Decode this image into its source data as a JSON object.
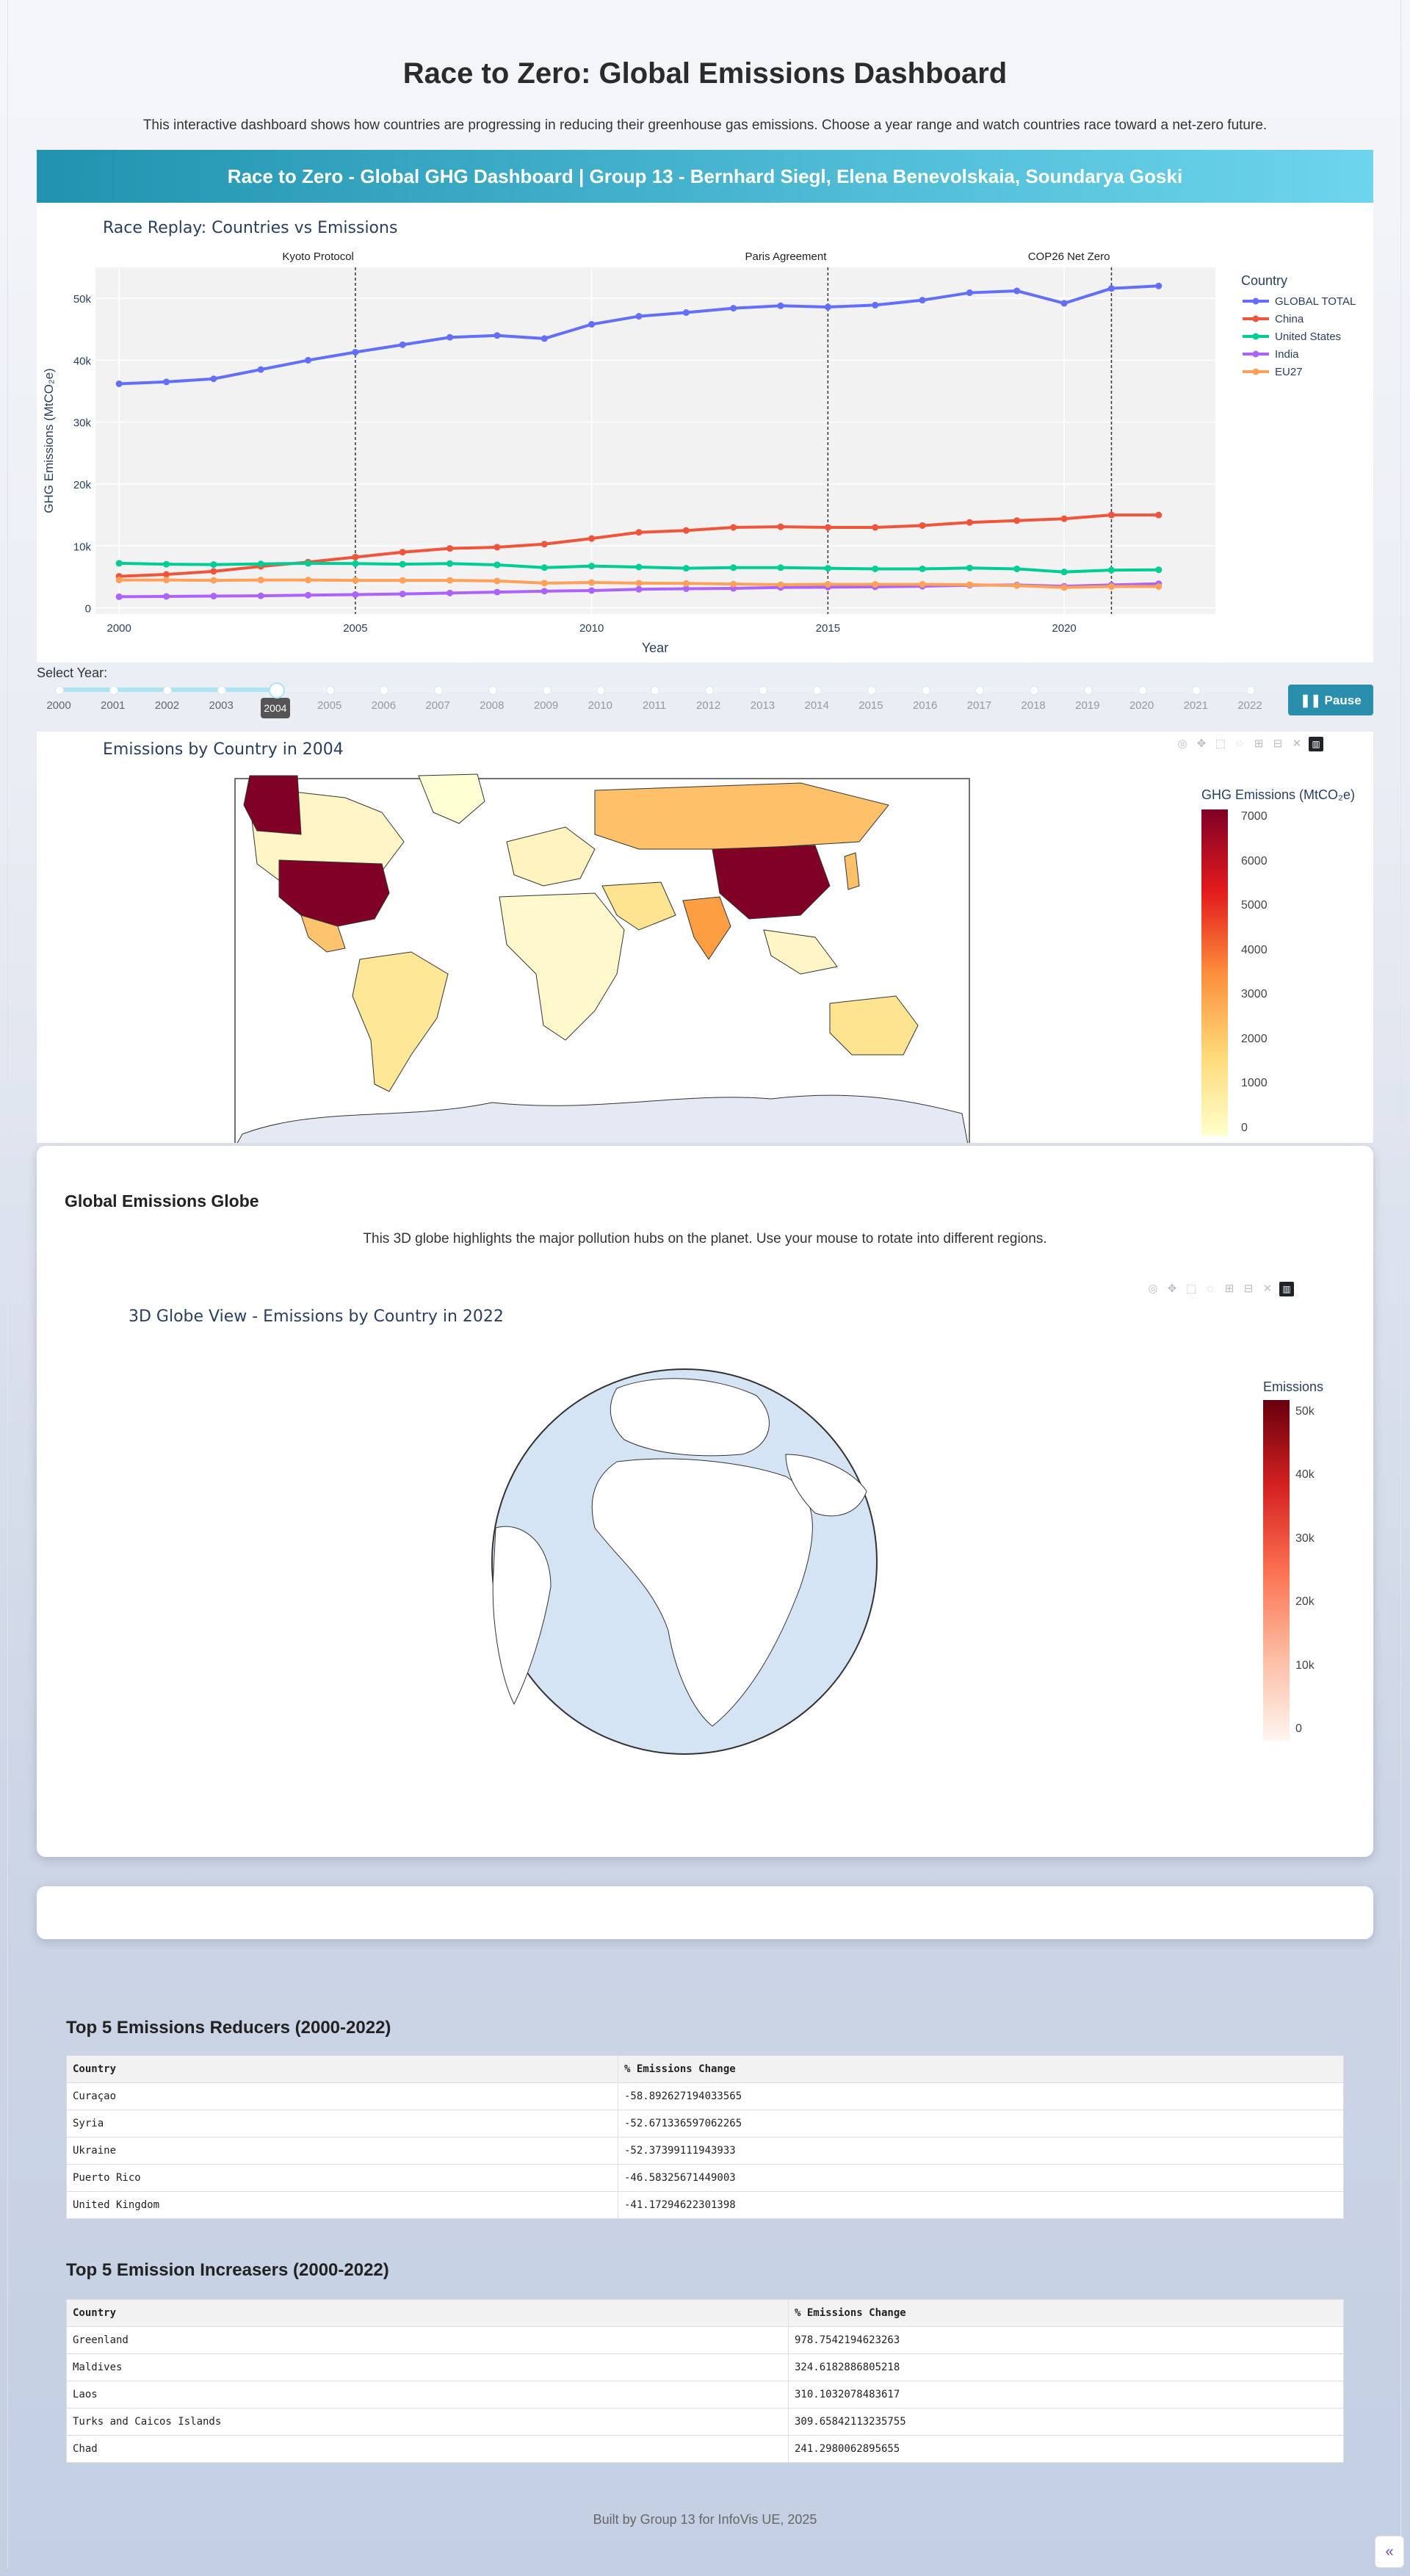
{
  "page": {
    "title": "Race to Zero: Global Emissions Dashboard",
    "intro": "This interactive dashboard shows how countries are progressing in reducing their greenhouse gas emissions. Choose a year range and watch countries race toward a net-zero future.",
    "banner": "Race to Zero - Global GHG Dashboard | Group 13 - Bernhard Siegl, Elena Benevolskaia, Soundarya Goski",
    "footer": "Built by Group 13 for InfoVis UE, 2025",
    "collapse_icon": "«"
  },
  "race_chart": {
    "title": "Race Replay: Countries vs Emissions",
    "legend_title": "Country",
    "annotations": [
      "Kyoto Protocol",
      "Paris Agreement",
      "COP26 Net Zero"
    ]
  },
  "slider": {
    "label": "Select Year:",
    "years": [
      "2000",
      "2001",
      "2002",
      "2003",
      "2004",
      "2005",
      "2006",
      "2007",
      "2008",
      "2009",
      "2010",
      "2011",
      "2012",
      "2013",
      "2014",
      "2015",
      "2016",
      "2017",
      "2018",
      "2019",
      "2020",
      "2021",
      "2022"
    ],
    "selected": "2004",
    "selected_index": 4,
    "pause_label": "❚❚ Pause"
  },
  "map_chart": {
    "title": "Emissions by Country in 2004",
    "colorbar_title": "GHG Emissions (MtCO₂e)",
    "colorbar_ticks": [
      "7000",
      "6000",
      "5000",
      "4000",
      "3000",
      "2000",
      "1000",
      "0"
    ]
  },
  "globe_card": {
    "title": "Global Emissions Globe",
    "description": "This 3D globe highlights the major pollution hubs on the planet. Use your mouse to rotate into different regions.",
    "chart_title": "3D Globe View - Emissions by Country in 2022",
    "colorbar_title": "Emissions",
    "colorbar_ticks": [
      "50k",
      "40k",
      "30k",
      "20k",
      "10k",
      "0"
    ]
  },
  "reducers": {
    "title": "Top 5 Emissions Reducers (2000-2022)",
    "headers": [
      "Country",
      "% Emissions Change"
    ],
    "rows": [
      [
        "Curaçao",
        "-58.892627194033565"
      ],
      [
        "Syria",
        "-52.671336597062265"
      ],
      [
        "Ukraine",
        "-52.37399111943933"
      ],
      [
        "Puerto Rico",
        "-46.58325671449003"
      ],
      [
        "United Kingdom",
        "-41.17294622301398"
      ]
    ]
  },
  "increasers": {
    "title": "Top 5 Emission Increasers (2000-2022)",
    "headers": [
      "Country",
      "% Emissions Change"
    ],
    "rows": [
      [
        "Greenland",
        "978.7542194623263"
      ],
      [
        "Maldives",
        "324.6182886805218"
      ],
      [
        "Laos",
        "310.1032078483617"
      ],
      [
        "Turks and Caicos Islands",
        "309.65842113235755"
      ],
      [
        "Chad",
        "241.2980062895655"
      ]
    ]
  },
  "chart_data": {
    "type": "line",
    "x": [
      2000,
      2001,
      2002,
      2003,
      2004,
      2005,
      2006,
      2007,
      2008,
      2009,
      2010,
      2011,
      2012,
      2013,
      2014,
      2015,
      2016,
      2017,
      2018,
      2019,
      2020,
      2021,
      2022
    ],
    "series": [
      {
        "name": "GLOBAL TOTAL",
        "color": "#636efa",
        "values": [
          36200,
          36500,
          37000,
          38500,
          40000,
          41300,
          42500,
          43700,
          44000,
          43500,
          45800,
          47100,
          47700,
          48400,
          48800,
          48600,
          48900,
          49700,
          50900,
          51200,
          49200,
          51600,
          52000
        ]
      },
      {
        "name": "China",
        "color": "#ef553b",
        "values": [
          5100,
          5400,
          5900,
          6700,
          7400,
          8200,
          9000,
          9600,
          9800,
          10300,
          11200,
          12200,
          12500,
          13000,
          13100,
          13000,
          13000,
          13300,
          13800,
          14100,
          14400,
          15000,
          15000
        ]
      },
      {
        "name": "United States",
        "color": "#00cc96",
        "values": [
          7200,
          7050,
          7000,
          7100,
          7200,
          7150,
          7050,
          7150,
          6950,
          6500,
          6750,
          6600,
          6400,
          6500,
          6500,
          6400,
          6300,
          6300,
          6450,
          6300,
          5800,
          6100,
          6150
        ]
      },
      {
        "name": "India",
        "color": "#ab63fa",
        "values": [
          1800,
          1850,
          1900,
          1950,
          2050,
          2150,
          2250,
          2400,
          2550,
          2700,
          2800,
          3000,
          3100,
          3150,
          3300,
          3350,
          3400,
          3500,
          3650,
          3700,
          3500,
          3700,
          3900
        ]
      },
      {
        "name": "EU27",
        "color": "#ffa15a",
        "values": [
          4500,
          4500,
          4450,
          4500,
          4500,
          4450,
          4450,
          4450,
          4350,
          4000,
          4100,
          4000,
          3950,
          3850,
          3750,
          3800,
          3800,
          3800,
          3750,
          3600,
          3300,
          3450,
          3450
        ]
      }
    ],
    "xlabel": "Year",
    "ylabel": "GHG Emissions (MtCO₂e)",
    "xlim": [
      1999.5,
      2023.2
    ],
    "ylim": [
      -1000,
      55000
    ],
    "yticks": [
      0,
      10000,
      20000,
      30000,
      40000,
      50000
    ],
    "ytick_labels": [
      "0",
      "10k",
      "20k",
      "30k",
      "40k",
      "50k"
    ],
    "xticks": [
      2000,
      2005,
      2010,
      2015,
      2020
    ],
    "vlines": [
      2005,
      2015,
      2021
    ],
    "legend": "right",
    "grid": true
  }
}
